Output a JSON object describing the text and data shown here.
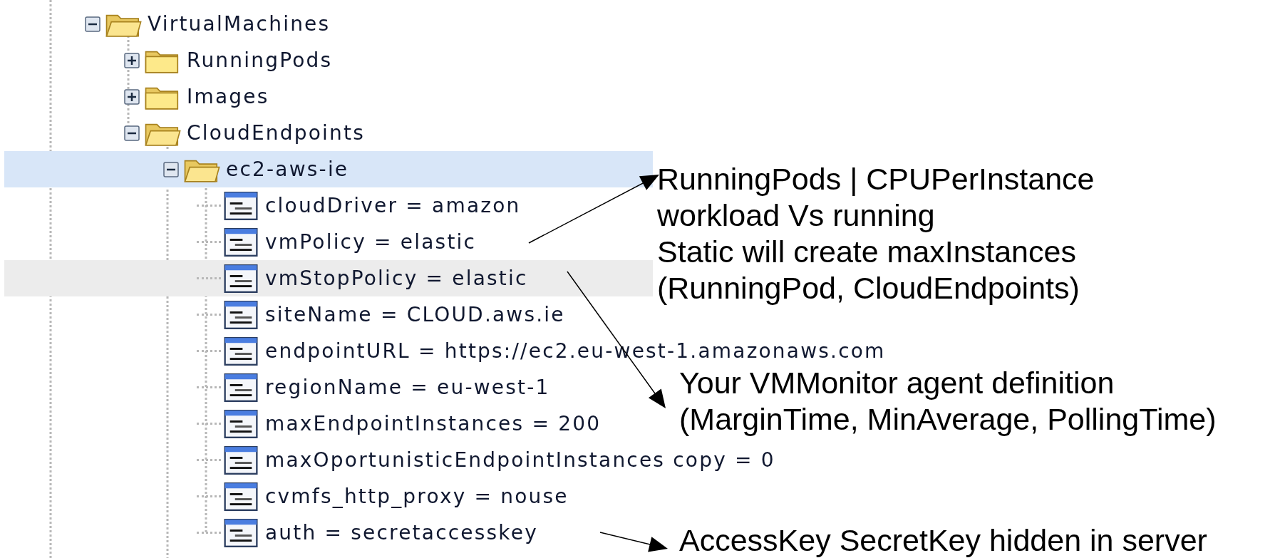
{
  "tree": [
    {
      "label": "VirtualMachines",
      "kind": "folder",
      "expanded": true,
      "selected": false,
      "hovered": false,
      "children": [
        {
          "label": "RunningPods",
          "kind": "folder",
          "expanded": false,
          "selected": false,
          "hovered": false
        },
        {
          "label": "Images",
          "kind": "folder",
          "expanded": false,
          "selected": false,
          "hovered": false
        },
        {
          "label": "CloudEndpoints",
          "kind": "folder",
          "expanded": true,
          "selected": false,
          "hovered": false,
          "children": [
            {
              "label": "ec2-aws-ie",
              "kind": "folder",
              "expanded": true,
              "selected": true,
              "hovered": false,
              "children": [
                {
                  "label": "cloudDriver = amazon",
                  "kind": "property",
                  "selected": false,
                  "hovered": false
                },
                {
                  "label": "vmPolicy = elastic",
                  "kind": "property",
                  "selected": false,
                  "hovered": false
                },
                {
                  "label": "vmStopPolicy = elastic",
                  "kind": "property",
                  "selected": false,
                  "hovered": true
                },
                {
                  "label": "siteName = CLOUD.aws.ie",
                  "kind": "property",
                  "selected": false,
                  "hovered": false
                },
                {
                  "label": "endpointURL = https://ec2.eu-west-1.amazonaws.com",
                  "kind": "property",
                  "selected": false,
                  "hovered": false
                },
                {
                  "label": "regionName = eu-west-1",
                  "kind": "property",
                  "selected": false,
                  "hovered": false
                },
                {
                  "label": "maxEndpointInstances = 200",
                  "kind": "property",
                  "selected": false,
                  "hovered": false
                },
                {
                  "label": "maxOportunisticEndpointInstances copy = 0",
                  "kind": "property",
                  "selected": false,
                  "hovered": false
                },
                {
                  "label": "cvmfs_http_proxy = nouse",
                  "kind": "property",
                  "selected": false,
                  "hovered": false
                },
                {
                  "label": "auth = secretaccesskey",
                  "kind": "property",
                  "selected": false,
                  "hovered": false
                }
              ]
            }
          ]
        }
      ]
    }
  ],
  "annotations": [
    {
      "lines": [
        "RunningPods | CPUPerInstance",
        "workload Vs running",
        "Static will create maxInstances",
        "(RunningPod, CloudEndpoints)"
      ]
    },
    {
      "lines": [
        "Your VMMonitor agent definition",
        "(MarginTime, MinAverage, PollingTime)"
      ]
    },
    {
      "lines": [
        "AccessKey SecretKey hidden in server"
      ]
    }
  ]
}
